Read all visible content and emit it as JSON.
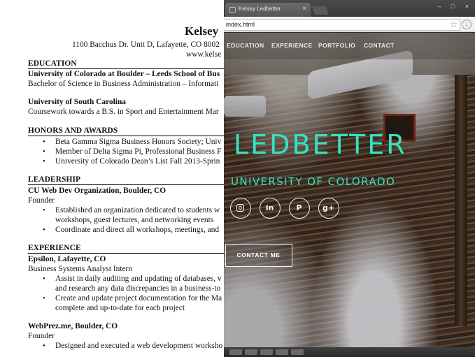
{
  "resume": {
    "name": "Kelsey",
    "address": "1100 Bacchus Dr. Unit D, Lafayette, CO 8002",
    "website": "www.kelse",
    "education": {
      "heading": "EDUCATION",
      "school1": "University of Colorado at Boulder – Leeds School of Bus",
      "degree1": "Bachelor of Science in Business Administration – Informati",
      "school2": "University of South Carolina",
      "degree2": "Coursework towards a B.S. in Sport and Entertainment Mar"
    },
    "honors": {
      "heading": "HONORS AND AWARDS",
      "items": [
        "Beta Gamma Sigma Business Honors Society; Univ",
        "Member of Delta Sigma Pi, Professional Business F",
        "University of Colorado Dean’s List Fall 2013-Sprin"
      ]
    },
    "leadership": {
      "heading": "LEADERSHIP",
      "org": "CU Web Dev Organization, Boulder, CO",
      "role": "Founder",
      "item1_line1": "Established an organization dedicated to students w",
      "item1_line2": "workshops, guest lectures, and networking events",
      "item2": "Coordinate and direct all workshops, meetings, and"
    },
    "experience": {
      "heading": "EXPERIENCE",
      "org1": "Epsilon, Lafayette, CO",
      "role1": "Business Systems Analyst Intern",
      "item1_line1": "Assist in daily auditing and updating of databases, v",
      "item1_line2": "and research any data discrepancies in a business-to",
      "item2_line1": "Create and update project documentation for the Ma",
      "item2_line2": "complete and up-to-date for each project",
      "org2": "WebPrez.me, Boulder, CO",
      "role2": "Founder",
      "item3": "Designed and executed a web development worksho"
    },
    "bullet": "•"
  },
  "browser": {
    "tab_title": "Kelsey Ledbetter",
    "tab_close": "×",
    "url": "index.html",
    "star": "☆",
    "info": "i",
    "win_min": "–",
    "win_max": "□",
    "win_close": "×"
  },
  "site": {
    "nav": [
      "EDUCATION",
      "EXPERIENCE",
      "PORTFOLIO",
      "CONTACT"
    ],
    "hero_name": "LEDBETTER",
    "hero_sub": "UNIVERSITY OF COLORADO",
    "social": {
      "linkedin": "in",
      "pinterest": "P",
      "google": "g+"
    },
    "contact_button": "CONTACT ME",
    "accent_color": "#35e3c0"
  }
}
